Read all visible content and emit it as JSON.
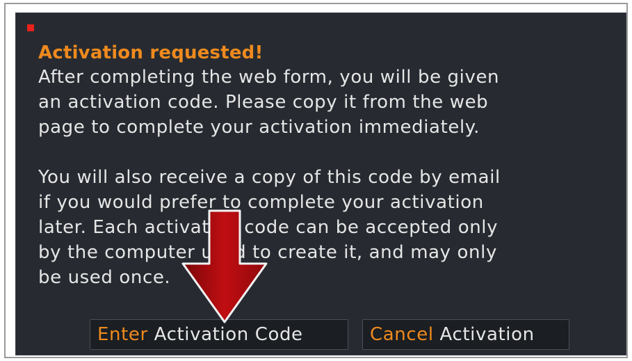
{
  "dialog": {
    "title": "Activation requested!",
    "paragraph1": "After completing the web form, you will be given\nan activation code.  Please copy it from the web\npage to complete your activation immediately.",
    "paragraph2": "You will also receive a copy of this code by email\nif you would prefer to complete your activation\nlater.  Each activation code can be accepted only\nby the computer used to create it, and may only\nbe used once."
  },
  "buttons": {
    "enter": {
      "accent": "Enter",
      "label": " Activation Code"
    },
    "cancel": {
      "accent": "Cancel",
      "label": " Activation"
    }
  },
  "colors": {
    "accent": "#ef8a1e",
    "dialog_bg": "#272b31",
    "text": "#e6e6e6",
    "arrow": "#c00e12"
  },
  "icons": {
    "corner_mark": "red-square-icon",
    "pointer": "down-arrow-icon"
  }
}
